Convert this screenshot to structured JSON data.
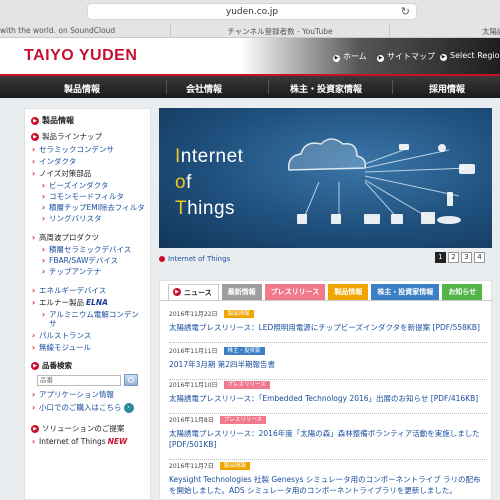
{
  "browser": {
    "url": "yuden.co.jp",
    "tabs": [
      "with the world. on SoundCloud",
      "チャンネル登録者数 - YouTube",
      "太陽誘"
    ]
  },
  "header": {
    "logo": "TAIYO YUDEN",
    "links": [
      "ホーム",
      "サイトマップ",
      "Select Region"
    ]
  },
  "nav": [
    "製品情報",
    "会社情報",
    "株主・投資家情報",
    "採用情報"
  ],
  "sidebar": {
    "title": "製品情報",
    "lineup_title": "製品ラインナップ",
    "items": [
      {
        "label": "セラミックコンデンサ",
        "level": 1
      },
      {
        "label": "インダクタ",
        "level": 1
      },
      {
        "label": "ノイズ対策部品",
        "level": 1
      },
      {
        "label": "ビーズインダクタ",
        "level": 2
      },
      {
        "label": "コモンモードフィルタ",
        "level": 2
      },
      {
        "label": "積層チップEMI除去フィルタ",
        "level": 2
      },
      {
        "label": "リングバリスタ",
        "level": 2
      },
      {
        "label": "高周波プロダクツ",
        "level": 1
      },
      {
        "label": "積層セラミックデバイス",
        "level": 2
      },
      {
        "label": "FBAR/SAWデバイス",
        "level": 2
      },
      {
        "label": "チップアンテナ",
        "level": 2
      },
      {
        "label": "エネルギーデバイス",
        "level": 1
      },
      {
        "label": "エルナー製品",
        "level": 1
      },
      {
        "label": "アルミニウム電解コンデンサ",
        "level": 2
      },
      {
        "label": "パルストランス",
        "level": 1
      },
      {
        "label": "無線モジュール",
        "level": 1
      }
    ],
    "elna_logo": "ELNA",
    "search_title": "品番検索",
    "search_placeholder": "品番",
    "app_info": "アプリケーション情報",
    "small_order": "小口でのご購入はこちら",
    "solutions_title": "ソリューションのご提案",
    "iot_link": "Internet of Things",
    "new_label": "NEW"
  },
  "banner": {
    "line1_initial": "I",
    "line1_rest": "nternet",
    "line2_initial": "o",
    "line2_rest": "f",
    "line3_initial": "T",
    "line3_rest": "hings",
    "caption": "Internet of Things",
    "pages": [
      "1",
      "2",
      "3",
      "4"
    ],
    "active_page": 1
  },
  "news": {
    "title": "ニュース",
    "tabs": [
      "最新情報",
      "プレスリリース",
      "製品情報",
      "株主・投資家情報",
      "お知らせ"
    ],
    "items": [
      {
        "date": "2016年11月22日",
        "badge": "製品情報",
        "badge_type": "prod",
        "title": "太陽誘電プレスリリース：LED照明用電源にチップビーズインダクタを新提案 [PDF/558KB]"
      },
      {
        "date": "2016年11月11日",
        "badge": "株主・投資家",
        "badge_type": "ir",
        "title": "2017年3月期 第2四半期報告書"
      },
      {
        "date": "2016年11月10日",
        "badge": "プレスリリース",
        "badge_type": "pr",
        "title": "太陽誘電プレスリリース：「Embedded Technology 2016」出展のお知らせ [PDF/416KB]"
      },
      {
        "date": "2016年11月8日",
        "badge": "プレスリリース",
        "badge_type": "pr",
        "title": "太陽誘電プレスリリース：2016年度「太陽の森」森林整備ボランティア活動を実施しました [PDF/501KB]"
      },
      {
        "date": "2016年11月7日",
        "badge": "製品情報",
        "badge_type": "prod",
        "title": "Keysight Technologies 社製 Genesys シミュレータ用のコンポーネントライブ ラリの配布を開始しました。ADS シミュレータ用のコンポーネントライブラリを更新しました。"
      }
    ]
  }
}
